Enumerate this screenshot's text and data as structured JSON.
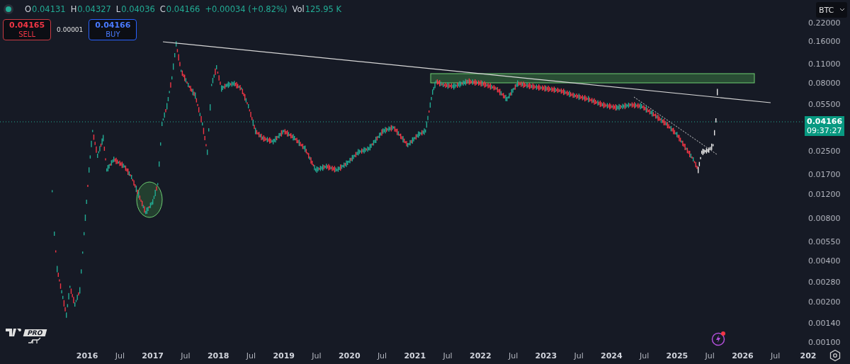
{
  "legend": {
    "ohlc": [
      {
        "label": "O",
        "value": "0.04131"
      },
      {
        "label": "H",
        "value": "0.04327"
      },
      {
        "label": "L",
        "value": "0.04036"
      },
      {
        "label": "C",
        "value": "0.04166"
      }
    ],
    "change": "+0.00034 (+0.82%)",
    "volume": {
      "label": "Vol",
      "value": "125.95 K"
    }
  },
  "trade": {
    "sell": {
      "price": "0.04165",
      "label": "SELL"
    },
    "spread": "0.00001",
    "buy": {
      "price": "0.04166",
      "label": "BUY"
    }
  },
  "currency_select": {
    "value": "BTC"
  },
  "price_axis": [
    "0.22000",
    "0.16000",
    "0.11000",
    "0.08000",
    "0.05500",
    "0.02500",
    "0.01700",
    "0.01200",
    "0.00800",
    "0.00550",
    "0.00400",
    "0.00280",
    "0.00200",
    "0.00140",
    "0.00100"
  ],
  "last_price": {
    "price": "0.04166",
    "countdown": "09:37:27"
  },
  "time_axis": [
    {
      "label": "2016",
      "kind": "year"
    },
    {
      "label": "Jul",
      "kind": "month"
    },
    {
      "label": "2017",
      "kind": "year"
    },
    {
      "label": "Jul",
      "kind": "month"
    },
    {
      "label": "2018",
      "kind": "year"
    },
    {
      "label": "Jul",
      "kind": "month"
    },
    {
      "label": "2019",
      "kind": "year"
    },
    {
      "label": "Jul",
      "kind": "month"
    },
    {
      "label": "2020",
      "kind": "year"
    },
    {
      "label": "Jul",
      "kind": "month"
    },
    {
      "label": "2021",
      "kind": "year"
    },
    {
      "label": "Jul",
      "kind": "month"
    },
    {
      "label": "2022",
      "kind": "year"
    },
    {
      "label": "Jul",
      "kind": "month"
    },
    {
      "label": "2023",
      "kind": "year"
    },
    {
      "label": "Jul",
      "kind": "month"
    },
    {
      "label": "2024",
      "kind": "year"
    },
    {
      "label": "Jul",
      "kind": "month"
    },
    {
      "label": "2025",
      "kind": "year"
    },
    {
      "label": "Jul",
      "kind": "month"
    },
    {
      "label": "2026",
      "kind": "year"
    },
    {
      "label": "Jul",
      "kind": "month"
    },
    {
      "label": "202",
      "kind": "year"
    }
  ],
  "logo": {
    "badge": "PRO"
  }
}
